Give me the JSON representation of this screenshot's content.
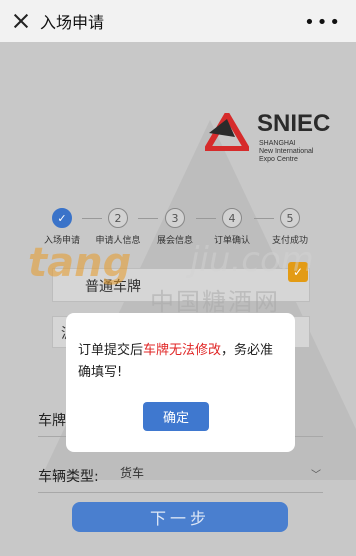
{
  "header": {
    "title": "入场申请",
    "more_icon": "more-dots-icon"
  },
  "logo": {
    "brand": "SNIEC",
    "sub_lines": [
      "SHANGHAI",
      "New International",
      "Expo Centre"
    ]
  },
  "steps": [
    {
      "number": "✓",
      "label": "入场申请",
      "active": true
    },
    {
      "number": "2",
      "label": "申请人信息",
      "active": false
    },
    {
      "number": "3",
      "label": "展会信息",
      "active": false
    },
    {
      "number": "4",
      "label": "订单确认",
      "active": false
    },
    {
      "number": "5",
      "label": "支付成功",
      "active": false
    }
  ],
  "form": {
    "plate_type": "普通车牌",
    "plate_input_fragment": "沪",
    "plate_label": "车牌",
    "vehicle_type_label": "车辆类型:",
    "vehicle_type_value": "货车"
  },
  "next_button": "下一步",
  "watermark": {
    "brand_cn": "中国糖酒网",
    "brand_latin": "tang",
    "brand_latin2": "jiu.com"
  },
  "dialog": {
    "text_before": "订单提交后",
    "text_highlight": "车牌无法修改",
    "text_after": "，务必准确填写!",
    "ok_label": "确定"
  },
  "colors": {
    "accent": "#3a73c9",
    "danger": "#e02424",
    "logo_red": "#d62b2b"
  }
}
